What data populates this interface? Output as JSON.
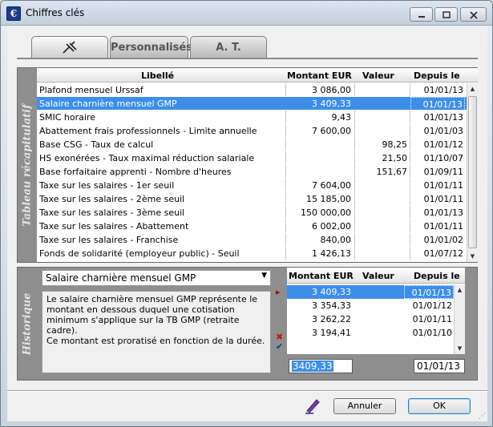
{
  "window": {
    "title": "Chiffres clés",
    "icon": "app-logo-icon"
  },
  "tabs": [
    {
      "label": "",
      "icon": "pushpin-icon"
    },
    {
      "label": "Personnalisés"
    },
    {
      "label": "A. T."
    }
  ],
  "summary": {
    "side_label": "Tableau récapitulatif",
    "columns": [
      "Libellé",
      "Montant EUR",
      "Valeur",
      "Depuis le"
    ],
    "rows": [
      [
        "Plafond mensuel Urssaf",
        "3 086,00",
        "",
        "01/01/13"
      ],
      [
        "Salaire charnière mensuel GMP",
        "3 409,33",
        "",
        "01/01/13"
      ],
      [
        "SMIC horaire",
        "9,43",
        "",
        "01/01/13"
      ],
      [
        "Abattement frais professionnels - Limite annuelle",
        "7 600,00",
        "",
        "01/01/03"
      ],
      [
        "Base CSG - Taux de calcul",
        "",
        "98,25",
        "01/01/12"
      ],
      [
        "HS exonérées - Taux maximal réduction salariale",
        "",
        "21,50",
        "01/10/07"
      ],
      [
        "Base forfaitaire apprenti - Nombre d'heures",
        "",
        "151,67",
        "01/09/11"
      ],
      [
        "Taxe sur les salaires - 1er seuil",
        "7 604,00",
        "",
        "01/01/11"
      ],
      [
        "Taxe sur les salaires - 2ème seuil",
        "15 185,00",
        "",
        "01/01/11"
      ],
      [
        "Taxe sur les salaires - 3ème seuil",
        "150 000,00",
        "",
        "01/01/13"
      ],
      [
        "Taxe sur les salaires - Abattement",
        "6 002,00",
        "",
        "01/01/11"
      ],
      [
        "Taxe sur les salaires - Franchise",
        "840,00",
        "",
        "01/01/02"
      ],
      [
        "Fonds de solidarité (employeur public) - Seuil",
        "1 426,13",
        "",
        "01/07/12"
      ]
    ],
    "selected_row": 1
  },
  "history": {
    "side_label": "Historique",
    "selected_item": "Salaire charnière mensuel GMP",
    "description": "Le salaire charnière mensuel GMP représente le montant en dessous duquel une cotisation minimum s'applique sur la TB GMP (retraite cadre).\nCe montant est proratisé en fonction de la durée.",
    "columns": [
      "Montant EUR",
      "Valeur",
      "Depuis le"
    ],
    "rows": [
      [
        "3 409,33",
        "",
        "01/01/13"
      ],
      [
        "3 354,33",
        "",
        "01/01/12"
      ],
      [
        "3 262,22",
        "",
        "01/01/11"
      ],
      [
        "3 194,41",
        "",
        "01/01/10"
      ]
    ],
    "edit_amount": "3409,33",
    "edit_date": "01/01/13"
  },
  "footer": {
    "cancel_label": "Annuler",
    "ok_label": "OK"
  },
  "colors": {
    "selection": "#3d8ee8",
    "panel": "#8e8e8e"
  }
}
